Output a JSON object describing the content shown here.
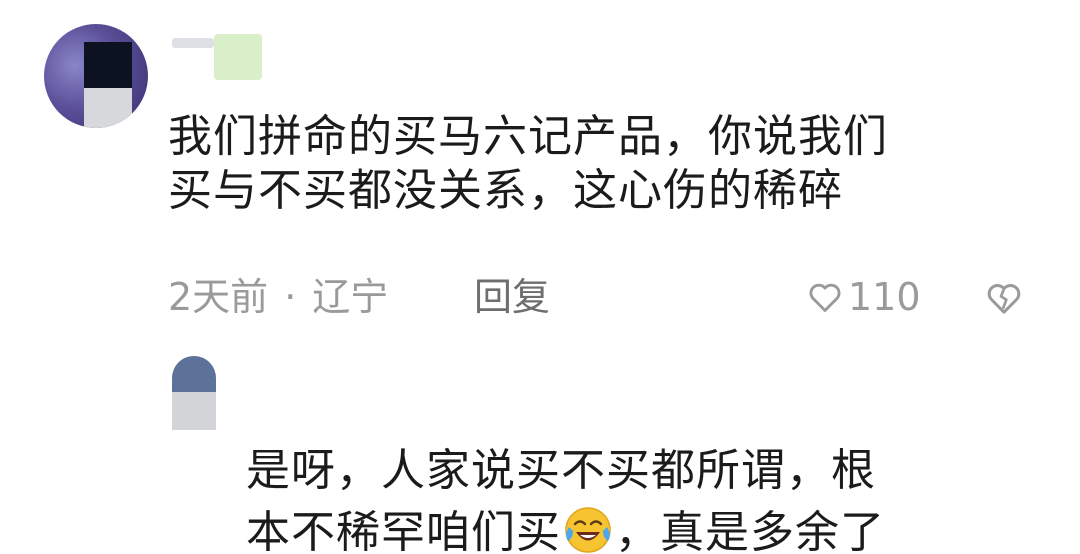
{
  "comment": {
    "text_line1": "我们拼命的买马六记产品，你说我们",
    "text_line2": "买与不买都没关系，这心伤的稀碎",
    "time": "2天前",
    "separator": "·",
    "location": "辽宁",
    "reply_label": "回复",
    "like_count": "110",
    "like_icon": "heart-outline-icon",
    "dislike_icon": "broken-heart-icon"
  },
  "reply": {
    "text_line1": "是呀，人家说买不买都所谓，根",
    "text_line2_before": "本不稀罕咱们买",
    "text_line2_after": "，真是多余了",
    "emoji_icon": "laughing-tears-emoji"
  },
  "colors": {
    "text_primary": "#1b1b1b",
    "text_secondary": "#9a9a9a",
    "reply_link": "#6e6e6e"
  }
}
